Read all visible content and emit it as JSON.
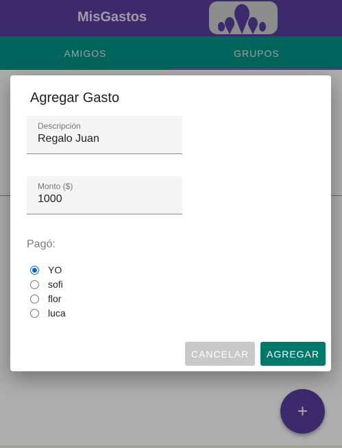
{
  "app": {
    "title": "MisGastos",
    "logo_icon": "group-people-icon"
  },
  "tabs": [
    {
      "label": "AMIGOS"
    },
    {
      "label": "GRUPOS"
    }
  ],
  "fab": {
    "label": "+",
    "icon": "plus-icon"
  },
  "dialog": {
    "title": "Agregar Gasto",
    "description_field": {
      "label": "Descripción",
      "value": "Regalo Juan"
    },
    "amount_field": {
      "label": "Monto ($)",
      "value": "1000"
    },
    "paid_by_label": "Pagó:",
    "paid_by_options": [
      {
        "label": "YO",
        "checked": true
      },
      {
        "label": "sofi",
        "checked": false
      },
      {
        "label": "flor",
        "checked": false
      },
      {
        "label": "luca",
        "checked": false
      }
    ],
    "cancel_label": "CANCELAR",
    "submit_label": "AGREGAR"
  },
  "colors": {
    "topbar": "#5a3fa0",
    "tabs": "#009688",
    "submit": "#00796b",
    "cancel": "#c8c8c8",
    "radio_checked": "#0b66d4"
  }
}
